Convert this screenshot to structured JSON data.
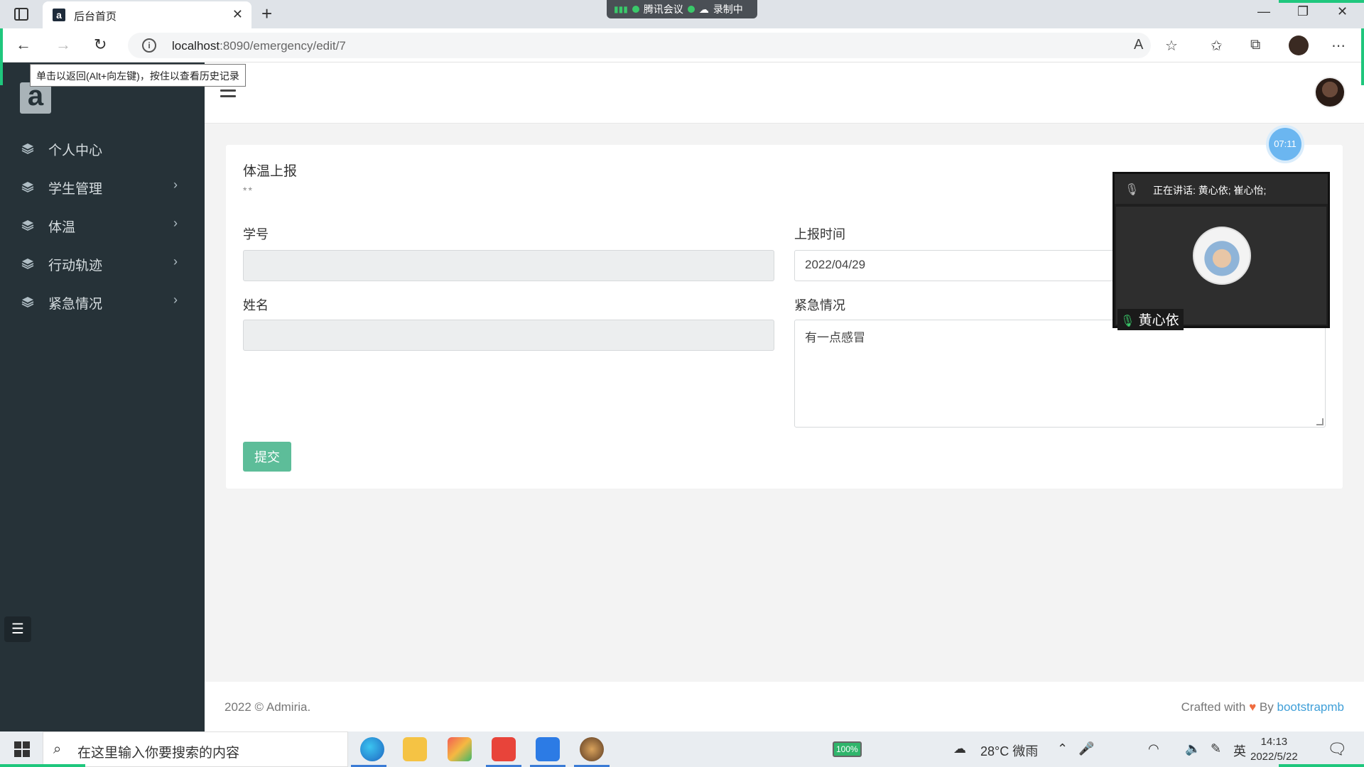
{
  "browser": {
    "tab_title": "后台首页",
    "url_host": "localhost",
    "url_rest": ":8090/emergency/edit/7",
    "tooltip": "单击以返回(Alt+向左键)，按住以查看历史记录"
  },
  "meeting": {
    "app_label": "腾讯会议",
    "recording_label": "录制中",
    "timer": "07:11",
    "speaking_text": "正在讲话: 黄心依; 崔心怡;",
    "participant_name": "黄心依"
  },
  "sidebar": {
    "items": [
      {
        "label": "个人中心",
        "has_arrow": false
      },
      {
        "label": "学生管理",
        "has_arrow": true
      },
      {
        "label": "体温",
        "has_arrow": true
      },
      {
        "label": "行动轨迹",
        "has_arrow": true
      },
      {
        "label": "紧急情况",
        "has_arrow": true
      }
    ]
  },
  "form": {
    "title": "体温上报",
    "subtitle": "**",
    "student_id_label": "学号",
    "student_id_value": "",
    "name_label": "姓名",
    "name_value": "",
    "report_time_label": "上报时间",
    "report_time_value": "2022/04/29",
    "emergency_label": "紧急情况",
    "emergency_value": "有一点感冒",
    "submit_label": "提交"
  },
  "footer": {
    "copyright": "2022 © Admiria.",
    "crafted": "Crafted with",
    "by": "By",
    "link": "bootstrapmb"
  },
  "taskbar": {
    "search_placeholder": "在这里输入你要搜索的内容",
    "battery": "100%",
    "weather": "28°C 微雨",
    "ime": "英",
    "time": "14:13",
    "date": "2022/5/22"
  },
  "colors": {
    "sidebar_bg": "#263238",
    "submit_bg": "#5dbd99",
    "link": "#3f9fd8",
    "record_green": "#1fc77d"
  }
}
